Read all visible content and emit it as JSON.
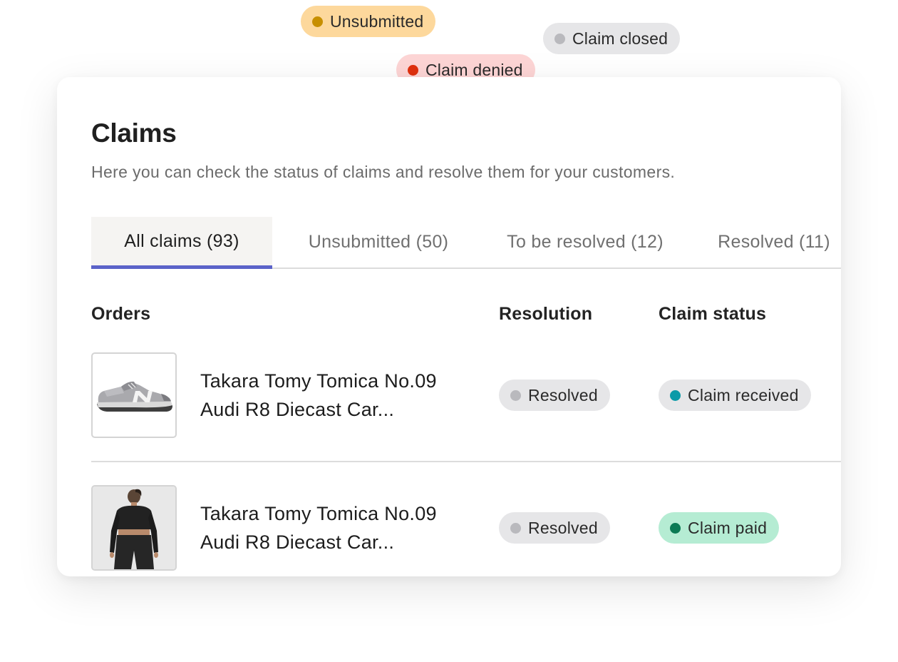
{
  "floating_chips": [
    {
      "label": "Unsubmitted",
      "bg": "#fdd89c",
      "dot": "#c78f00"
    },
    {
      "label": "Claim closed",
      "bg": "#e6e6e8",
      "dot": "#b9b9bd"
    },
    {
      "label": "Claim denied",
      "bg": "#fdd5d5",
      "dot": "#e0300e"
    }
  ],
  "card": {
    "title": "Claims",
    "subtitle": "Here you can check the status of claims and resolve them for your customers."
  },
  "tabs": [
    {
      "label": "All claims (93)",
      "active": true
    },
    {
      "label": "Unsubmitted (50)",
      "active": false
    },
    {
      "label": "To be resolved (12)",
      "active": false
    },
    {
      "label": "Resolved (11)",
      "active": false
    }
  ],
  "columns": {
    "orders": "Orders",
    "resolution": "Resolution",
    "status": "Claim status"
  },
  "rows": [
    {
      "thumbnail_icon": "sneaker-image",
      "product_line1": "Takara Tomy Tomica No.09",
      "product_line2": "Audi R8 Diecast Car...",
      "resolution": {
        "label": "Resolved",
        "bg": "#e6e6e8",
        "dot": "#b9b9bd"
      },
      "status": {
        "label": "Claim received",
        "bg": "#e6e6e8",
        "dot": "#0a9aa8"
      }
    },
    {
      "thumbnail_icon": "apparel-image",
      "product_line1": "Takara Tomy Tomica No.09",
      "product_line2": "Audi R8 Diecast Car...",
      "resolution": {
        "label": "Resolved",
        "bg": "#e6e6e8",
        "dot": "#b9b9bd"
      },
      "status": {
        "label": "Claim paid",
        "bg": "#b5ecd3",
        "dot": "#0b7a54"
      }
    }
  ],
  "colors": {
    "accent": "#5b63c9",
    "tab_active_bg": "#f5f4f2",
    "divider": "#dcdcdc"
  }
}
